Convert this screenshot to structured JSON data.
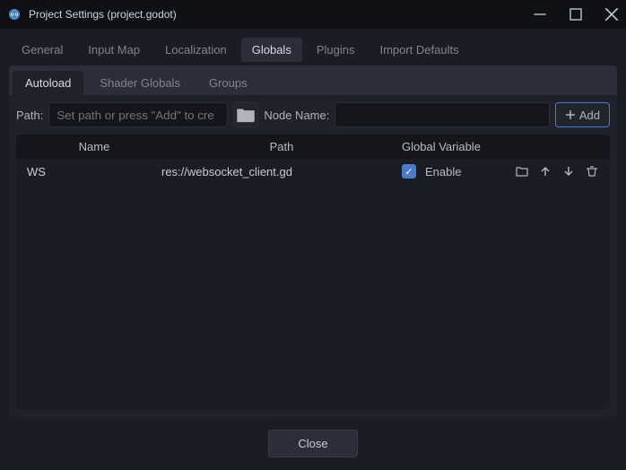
{
  "window": {
    "title": "Project Settings (project.godot)"
  },
  "tabs": {
    "items": [
      "General",
      "Input Map",
      "Localization",
      "Globals",
      "Plugins",
      "Import Defaults"
    ],
    "active": "Globals"
  },
  "subtabs": {
    "items": [
      "Autoload",
      "Shader Globals",
      "Groups"
    ],
    "active": "Autoload"
  },
  "toolbar": {
    "path_label": "Path:",
    "path_placeholder": "Set path or press \"Add\" to cre",
    "node_name_label": "Node Name:",
    "add_label": "Add"
  },
  "table": {
    "headers": {
      "name": "Name",
      "path": "Path",
      "global_var": "Global Variable"
    },
    "rows": [
      {
        "name": "WS",
        "path": "res://websocket_client.gd",
        "enabled": true,
        "enable_label": "Enable"
      }
    ]
  },
  "footer": {
    "close_label": "Close"
  }
}
